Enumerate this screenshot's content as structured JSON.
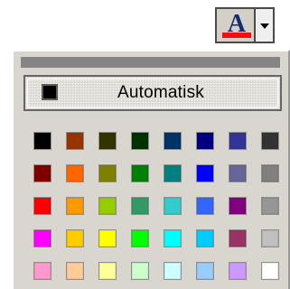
{
  "toolbar": {
    "font_color_button": {
      "letter": "A",
      "current_color": "#ef1111",
      "dropdown_icon": "dropdown-arrow-icon"
    }
  },
  "palette": {
    "automatic_label": "Automatisk",
    "automatic_color": "#000000",
    "swatches": [
      [
        "#000000",
        "#993300",
        "#333300",
        "#003300",
        "#003366",
        "#000080",
        "#333399",
        "#333333"
      ],
      [
        "#800000",
        "#ff6600",
        "#808000",
        "#008000",
        "#008080",
        "#0000ff",
        "#666699",
        "#808080"
      ],
      [
        "#ff0000",
        "#ff9900",
        "#99cc00",
        "#339966",
        "#33cccc",
        "#3366ff",
        "#800080",
        "#969696"
      ],
      [
        "#ff00ff",
        "#ffcc00",
        "#ffff00",
        "#00ff00",
        "#00ffff",
        "#00ccff",
        "#993366",
        "#c0c0c0"
      ],
      [
        "#ff99cc",
        "#ffcc99",
        "#ffff99",
        "#ccffcc",
        "#ccffff",
        "#99ccff",
        "#cc99ff",
        "#ffffff"
      ]
    ]
  }
}
